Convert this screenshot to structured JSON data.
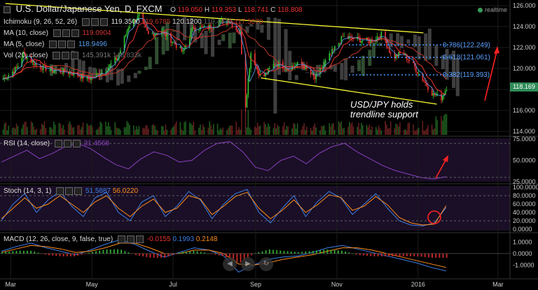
{
  "header": {
    "title": "U.S. Dollar/Japanese Yen, D, FXCM",
    "ohlc": [
      {
        "k": "O",
        "v": "119.050"
      },
      {
        "k": "H",
        "v": "119.353"
      },
      {
        "k": "L",
        "v": "118.741"
      },
      {
        "k": "C",
        "v": "118.808"
      }
    ],
    "realtime_label": "realtime"
  },
  "indicators": {
    "ichimoku": {
      "label": "Ichimoku (9, 26, 52, 26)",
      "values": [
        "119.3500",
        "119.6785",
        "120.1200",
        "119.4430",
        "117.5070"
      ],
      "colors": [
        "#e0e0e0",
        "#c0392b",
        "#d4d4d4",
        "#666666",
        "#c0392b"
      ]
    },
    "ma10": {
      "label": "MA (10, close)",
      "value": "119.0904",
      "color": "#d03030"
    },
    "ma5": {
      "label": "MA (5, close)",
      "value": "118.9496",
      "color": "#5aa0f0"
    },
    "vol": {
      "label": "Vol (20, close)",
      "values": [
        "145,391k",
        "148,833k"
      ]
    },
    "rsi": {
      "label": "RSI (14, close)",
      "value": "31.4568"
    },
    "stoch": {
      "label": "Stoch (14, 3, 1)",
      "values": [
        "51.5887",
        "56.0220"
      ]
    },
    "macd": {
      "label": "MACD (12, 26, close, 9, false, true)",
      "values": [
        "-0.0155",
        "0.1993",
        "0.2148"
      ]
    }
  },
  "price_tag": {
    "value": "118.169",
    "color": "#2e8b57"
  },
  "annotation": "USD/JPY holds trendline support",
  "colors": {
    "bull": "#33cc33",
    "bear": "#ee3333",
    "trendline": "#ffff33",
    "fib": "#4499ff",
    "arrow": "#ff2222",
    "rsi_line": "#8a3fbf",
    "stoch_k": "#3d7ee8",
    "stoch_d": "#ff8c1a",
    "macd_line": "#3d7ee8",
    "macd_signal": "#ff8c1a",
    "cloud_bull": "#2f4f2f",
    "cloud_bear": "#4f4f4f"
  },
  "chart_data": [
    {
      "type": "candlestick",
      "panel": "price",
      "ylim": [
        114,
        126
      ],
      "x_axis_ticks": [
        "Mar",
        "May",
        "Jul",
        "Sep",
        "Nov",
        "2016",
        "Mar"
      ],
      "y_axis_ticks": [
        "126.000",
        "124.000",
        "122.000",
        "120.000",
        "118.000",
        "116.000",
        "114.000"
      ],
      "x_range": [
        "2015-02-21",
        "2016-03-10"
      ],
      "fib_levels": [
        {
          "label": "0.786(122.249)",
          "value": 122.249
        },
        {
          "label": "0.618(121.061)",
          "value": 121.061
        },
        {
          "label": "0.382(119.393)",
          "value": 119.393
        }
      ],
      "trendline_upper": [
        {
          "date": "2015-02-25",
          "value": 126.2
        },
        {
          "date": "2016-01-05",
          "value": 123.4
        }
      ],
      "trendline_lower": [
        {
          "date": "2015-09-05",
          "value": 119.1
        },
        {
          "date": "2016-01-15",
          "value": 116.6
        }
      ],
      "close_path": [
        {
          "date": "2015-02-22",
          "value": 118.9
        },
        {
          "date": "2015-03-05",
          "value": 120.0
        },
        {
          "date": "2015-03-10",
          "value": 121.4
        },
        {
          "date": "2015-03-20",
          "value": 120.3
        },
        {
          "date": "2015-04-01",
          "value": 119.8
        },
        {
          "date": "2015-04-15",
          "value": 119.6
        },
        {
          "date": "2015-04-28",
          "value": 119.0
        },
        {
          "date": "2015-05-10",
          "value": 119.8
        },
        {
          "date": "2015-05-20",
          "value": 121.0
        },
        {
          "date": "2015-05-28",
          "value": 124.0
        },
        {
          "date": "2015-06-05",
          "value": 125.0
        },
        {
          "date": "2015-06-12",
          "value": 123.2
        },
        {
          "date": "2015-06-22",
          "value": 123.6
        },
        {
          "date": "2015-07-01",
          "value": 122.5
        },
        {
          "date": "2015-07-08",
          "value": 121.5
        },
        {
          "date": "2015-07-16",
          "value": 124.0
        },
        {
          "date": "2015-07-25",
          "value": 123.8
        },
        {
          "date": "2015-08-05",
          "value": 124.4
        },
        {
          "date": "2015-08-12",
          "value": 124.6
        },
        {
          "date": "2015-08-20",
          "value": 123.3
        },
        {
          "date": "2015-08-24",
          "value": 116.5
        },
        {
          "date": "2015-08-28",
          "value": 121.5
        },
        {
          "date": "2015-09-05",
          "value": 119.0
        },
        {
          "date": "2015-09-15",
          "value": 120.5
        },
        {
          "date": "2015-09-25",
          "value": 120.1
        },
        {
          "date": "2015-10-05",
          "value": 120.5
        },
        {
          "date": "2015-10-15",
          "value": 119.0
        },
        {
          "date": "2015-10-25",
          "value": 121.0
        },
        {
          "date": "2015-11-05",
          "value": 123.0
        },
        {
          "date": "2015-11-15",
          "value": 122.8
        },
        {
          "date": "2015-11-25",
          "value": 122.6
        },
        {
          "date": "2015-12-05",
          "value": 123.3
        },
        {
          "date": "2015-12-12",
          "value": 121.0
        },
        {
          "date": "2015-12-20",
          "value": 121.5
        },
        {
          "date": "2015-12-28",
          "value": 120.3
        },
        {
          "date": "2016-01-05",
          "value": 118.8
        },
        {
          "date": "2016-01-12",
          "value": 117.5
        },
        {
          "date": "2016-01-18",
          "value": 117.2
        },
        {
          "date": "2016-01-22",
          "value": 118.2
        }
      ]
    },
    {
      "type": "line",
      "panel": "rsi",
      "ylim": [
        25,
        75
      ],
      "y_axis_ticks": [
        "75.0000",
        "50.0000",
        "25.0000"
      ],
      "series": [
        {
          "values": [
            48,
            55,
            62,
            52,
            58,
            66,
            70,
            64,
            54,
            45,
            40,
            52,
            60,
            56,
            48,
            50,
            62,
            70,
            72,
            60,
            42,
            38,
            50,
            55,
            46,
            58,
            66,
            70,
            60,
            52,
            44,
            38,
            34,
            30,
            28,
            31
          ]
        }
      ]
    },
    {
      "type": "line",
      "panel": "stoch",
      "ylim": [
        0,
        100
      ],
      "y_axis_ticks": [
        "100.0000",
        "80.0000",
        "60.0000",
        "40.0000",
        "20.0000",
        "0.0000"
      ],
      "series": [
        {
          "values": [
            20,
            60,
            85,
            40,
            70,
            90,
            55,
            30,
            75,
            88,
            40,
            20,
            65,
            80,
            30,
            55,
            90,
            70,
            25,
            60,
            85,
            95,
            40,
            15,
            50,
            80,
            30,
            65,
            90,
            75,
            35,
            60,
            85,
            50,
            20,
            10,
            8,
            15,
            52
          ]
        },
        {
          "values": [
            25,
            50,
            75,
            50,
            60,
            80,
            60,
            40,
            65,
            80,
            50,
            30,
            55,
            72,
            40,
            50,
            80,
            72,
            35,
            55,
            78,
            88,
            50,
            25,
            45,
            70,
            40,
            58,
            82,
            76,
            45,
            55,
            78,
            58,
            28,
            15,
            10,
            12,
            56
          ]
        }
      ]
    },
    {
      "type": "line",
      "panel": "macd",
      "ylim": [
        -2,
        1.5
      ],
      "y_axis_ticks": [
        "1.0000",
        "0.0000",
        "-1.0000"
      ],
      "series": [
        {
          "values": [
            0.2,
            0.6,
            0.9,
            0.5,
            0.2,
            -0.1,
            0.3,
            0.8,
            1.2,
            0.8,
            0.2,
            -0.3,
            0.1,
            0.5,
            0.3,
            -0.2,
            -1.6,
            -1.0,
            -0.5,
            -0.3,
            -0.2,
            0.1,
            0.5,
            0.7,
            0.4,
            0.1,
            -0.2,
            -0.5,
            -0.8,
            -1.2,
            -1.5
          ]
        },
        {
          "values": [
            0.1,
            0.4,
            0.7,
            0.6,
            0.4,
            0.1,
            0.2,
            0.5,
            0.9,
            0.9,
            0.5,
            0.0,
            0.0,
            0.3,
            0.3,
            0.0,
            -0.9,
            -1.0,
            -0.8,
            -0.5,
            -0.3,
            -0.1,
            0.2,
            0.5,
            0.5,
            0.3,
            0.0,
            -0.3,
            -0.6,
            -0.9,
            -1.2
          ]
        }
      ]
    }
  ]
}
